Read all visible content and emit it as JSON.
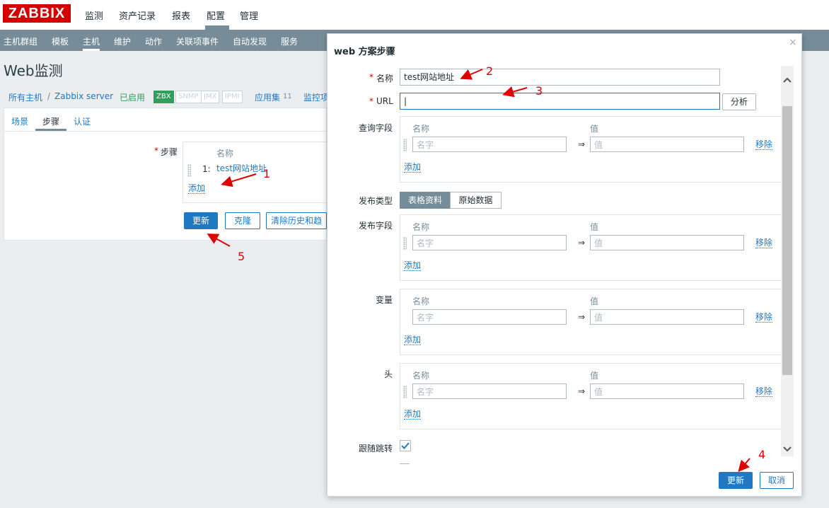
{
  "app": {
    "logo": "ZABBIX",
    "menu": [
      "监测",
      "资产记录",
      "报表",
      "配置",
      "管理"
    ],
    "submenu": [
      "主机群组",
      "模板",
      "主机",
      "维护",
      "动作",
      "关联项事件",
      "自动发现",
      "服务"
    ]
  },
  "page": {
    "title": "Web监测",
    "breadcrumb": {
      "all_hosts": "所有主机",
      "sep": "/",
      "host": "Zabbix server",
      "enabled": "已启用",
      "tags": [
        "ZBX",
        "SNMP",
        "JMX",
        "IPMI"
      ],
      "apps": "应用集",
      "apps_count": "11",
      "items": "监控项"
    },
    "tabs": [
      "场景",
      "步骤",
      "认证"
    ],
    "steps": {
      "label": "步骤",
      "required": "*",
      "col_name": "名称",
      "row_index": "1:",
      "row_name": "test网站地址",
      "add": "添加"
    },
    "buttons": {
      "update": "更新",
      "clone": "克隆",
      "clear": "清除历史和趋"
    }
  },
  "dialog": {
    "title": "web 方案步骤",
    "close": "×",
    "name_label": "名称",
    "name_value": "test网站地址",
    "url_label": "URL",
    "url_value": "|",
    "parse": "分析",
    "query_label": "查询字段",
    "post_type_label": "发布类型",
    "post_type_options": [
      "表格资料",
      "原始数据"
    ],
    "post_fields_label": "发布字段",
    "variables_label": "变量",
    "headers_label": "头",
    "follow_label": "跟随跳转",
    "col_name": "名称",
    "col_value": "值",
    "placeholder_name": "名字",
    "placeholder_value": "值",
    "arrow": "⇒",
    "remove": "移除",
    "add": "添加",
    "required": "*",
    "update": "更新",
    "cancel": "取消"
  },
  "annotations": [
    "1",
    "2",
    "3",
    "4",
    "5"
  ],
  "colors": {
    "logo": "#d40000",
    "subnav": "#768d99",
    "link": "#1f78c1",
    "annotation": "#e00000"
  }
}
